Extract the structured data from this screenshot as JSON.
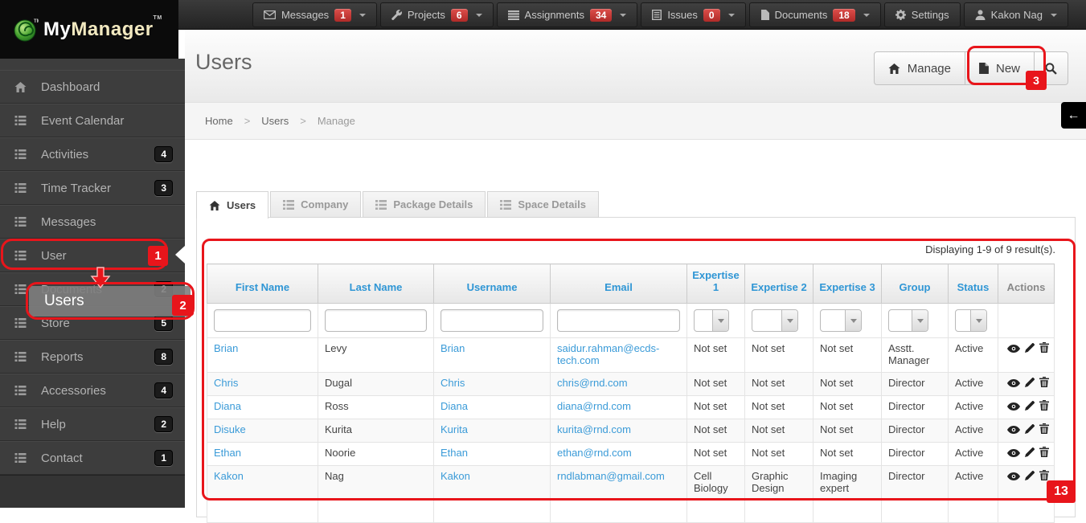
{
  "brand": {
    "name_my": "My",
    "name_manager": "Manager",
    "tm": "TM"
  },
  "topbar": {
    "items": [
      {
        "label": "Messages",
        "badge": "1",
        "icon": "envelope-icon"
      },
      {
        "label": "Projects",
        "badge": "6",
        "icon": "wrench-icon"
      },
      {
        "label": "Assignments",
        "badge": "34",
        "icon": "bars-icon"
      },
      {
        "label": "Issues",
        "badge": "0",
        "icon": "document-lines-icon"
      },
      {
        "label": "Documents",
        "badge": "18",
        "icon": "file-icon"
      }
    ],
    "settings_label": "Settings",
    "user_label": "Kakon Nag"
  },
  "sidebar": {
    "items": [
      {
        "label": "Dashboard",
        "badge": ""
      },
      {
        "label": "Event Calendar",
        "badge": ""
      },
      {
        "label": "Activities",
        "badge": "4"
      },
      {
        "label": "Time Tracker",
        "badge": "3"
      },
      {
        "label": "Messages",
        "badge": ""
      },
      {
        "label": "User",
        "badge": ""
      },
      {
        "label": "Documents",
        "badge": "2"
      },
      {
        "label": "Store",
        "badge": "5"
      },
      {
        "label": "Reports",
        "badge": "8"
      },
      {
        "label": "Accessories",
        "badge": "4"
      },
      {
        "label": "Help",
        "badge": "2"
      },
      {
        "label": "Contact",
        "badge": "1"
      }
    ]
  },
  "page": {
    "title": "Users"
  },
  "header_buttons": {
    "manage": "Manage",
    "new": "New"
  },
  "breadcrumb": {
    "home": "Home",
    "users": "Users",
    "current": "Manage",
    "sep": ">"
  },
  "back_arrow": "←",
  "tabs": [
    {
      "label": "Users"
    },
    {
      "label": "Company"
    },
    {
      "label": "Package Details"
    },
    {
      "label": "Space Details"
    }
  ],
  "grid": {
    "summary": "Displaying 1-9 of 9 result(s).",
    "columns": [
      "First Name",
      "Last Name",
      "Username",
      "Email",
      "Expertise 1",
      "Expertise 2",
      "Expertise 3",
      "Group",
      "Status",
      "Actions"
    ],
    "rows": [
      {
        "first_name": "Brian",
        "last_name": "Levy",
        "username": "Brian",
        "email": "saidur.rahman@ecds-tech.com",
        "expertise1": "Not set",
        "expertise2": "Not set",
        "expertise3": "Not set",
        "group": "Asstt. Manager",
        "status": "Active"
      },
      {
        "first_name": "Chris",
        "last_name": "Dugal",
        "username": "Chris",
        "email": "chris@rnd.com",
        "expertise1": "Not set",
        "expertise2": "Not set",
        "expertise3": "Not set",
        "group": "Director",
        "status": "Active"
      },
      {
        "first_name": "Diana",
        "last_name": "Ross",
        "username": "Diana",
        "email": "diana@rnd.com",
        "expertise1": "Not set",
        "expertise2": "Not set",
        "expertise3": "Not set",
        "group": "Director",
        "status": "Active"
      },
      {
        "first_name": "Disuke",
        "last_name": "Kurita",
        "username": "Kurita",
        "email": "kurita@rnd.com",
        "expertise1": "Not set",
        "expertise2": "Not set",
        "expertise3": "Not set",
        "group": "Director",
        "status": "Active"
      },
      {
        "first_name": "Ethan",
        "last_name": "Noorie",
        "username": "Ethan",
        "email": "ethan@rnd.com",
        "expertise1": "Not set",
        "expertise2": "Not set",
        "expertise3": "Not set",
        "group": "Director",
        "status": "Active"
      },
      {
        "first_name": "Kakon",
        "last_name": "Nag",
        "username": "Kakon",
        "email": "rndlabman@gmail.com",
        "expertise1": "Cell Biology",
        "expertise2": "Graphic Design",
        "expertise3": "Imaging expert",
        "group": "Director",
        "status": "Active"
      }
    ]
  },
  "annotations": {
    "step1": "1",
    "step2": "2",
    "step3": "3",
    "step13": "13",
    "popup_label": "Users",
    "accent_red": "#e8151b"
  },
  "colors": {
    "link_blue": "#3b9bd8",
    "header_blue": "#2f96d5",
    "badge_red": "#c9302c",
    "sidebar_bg": "#3d3d3d"
  }
}
